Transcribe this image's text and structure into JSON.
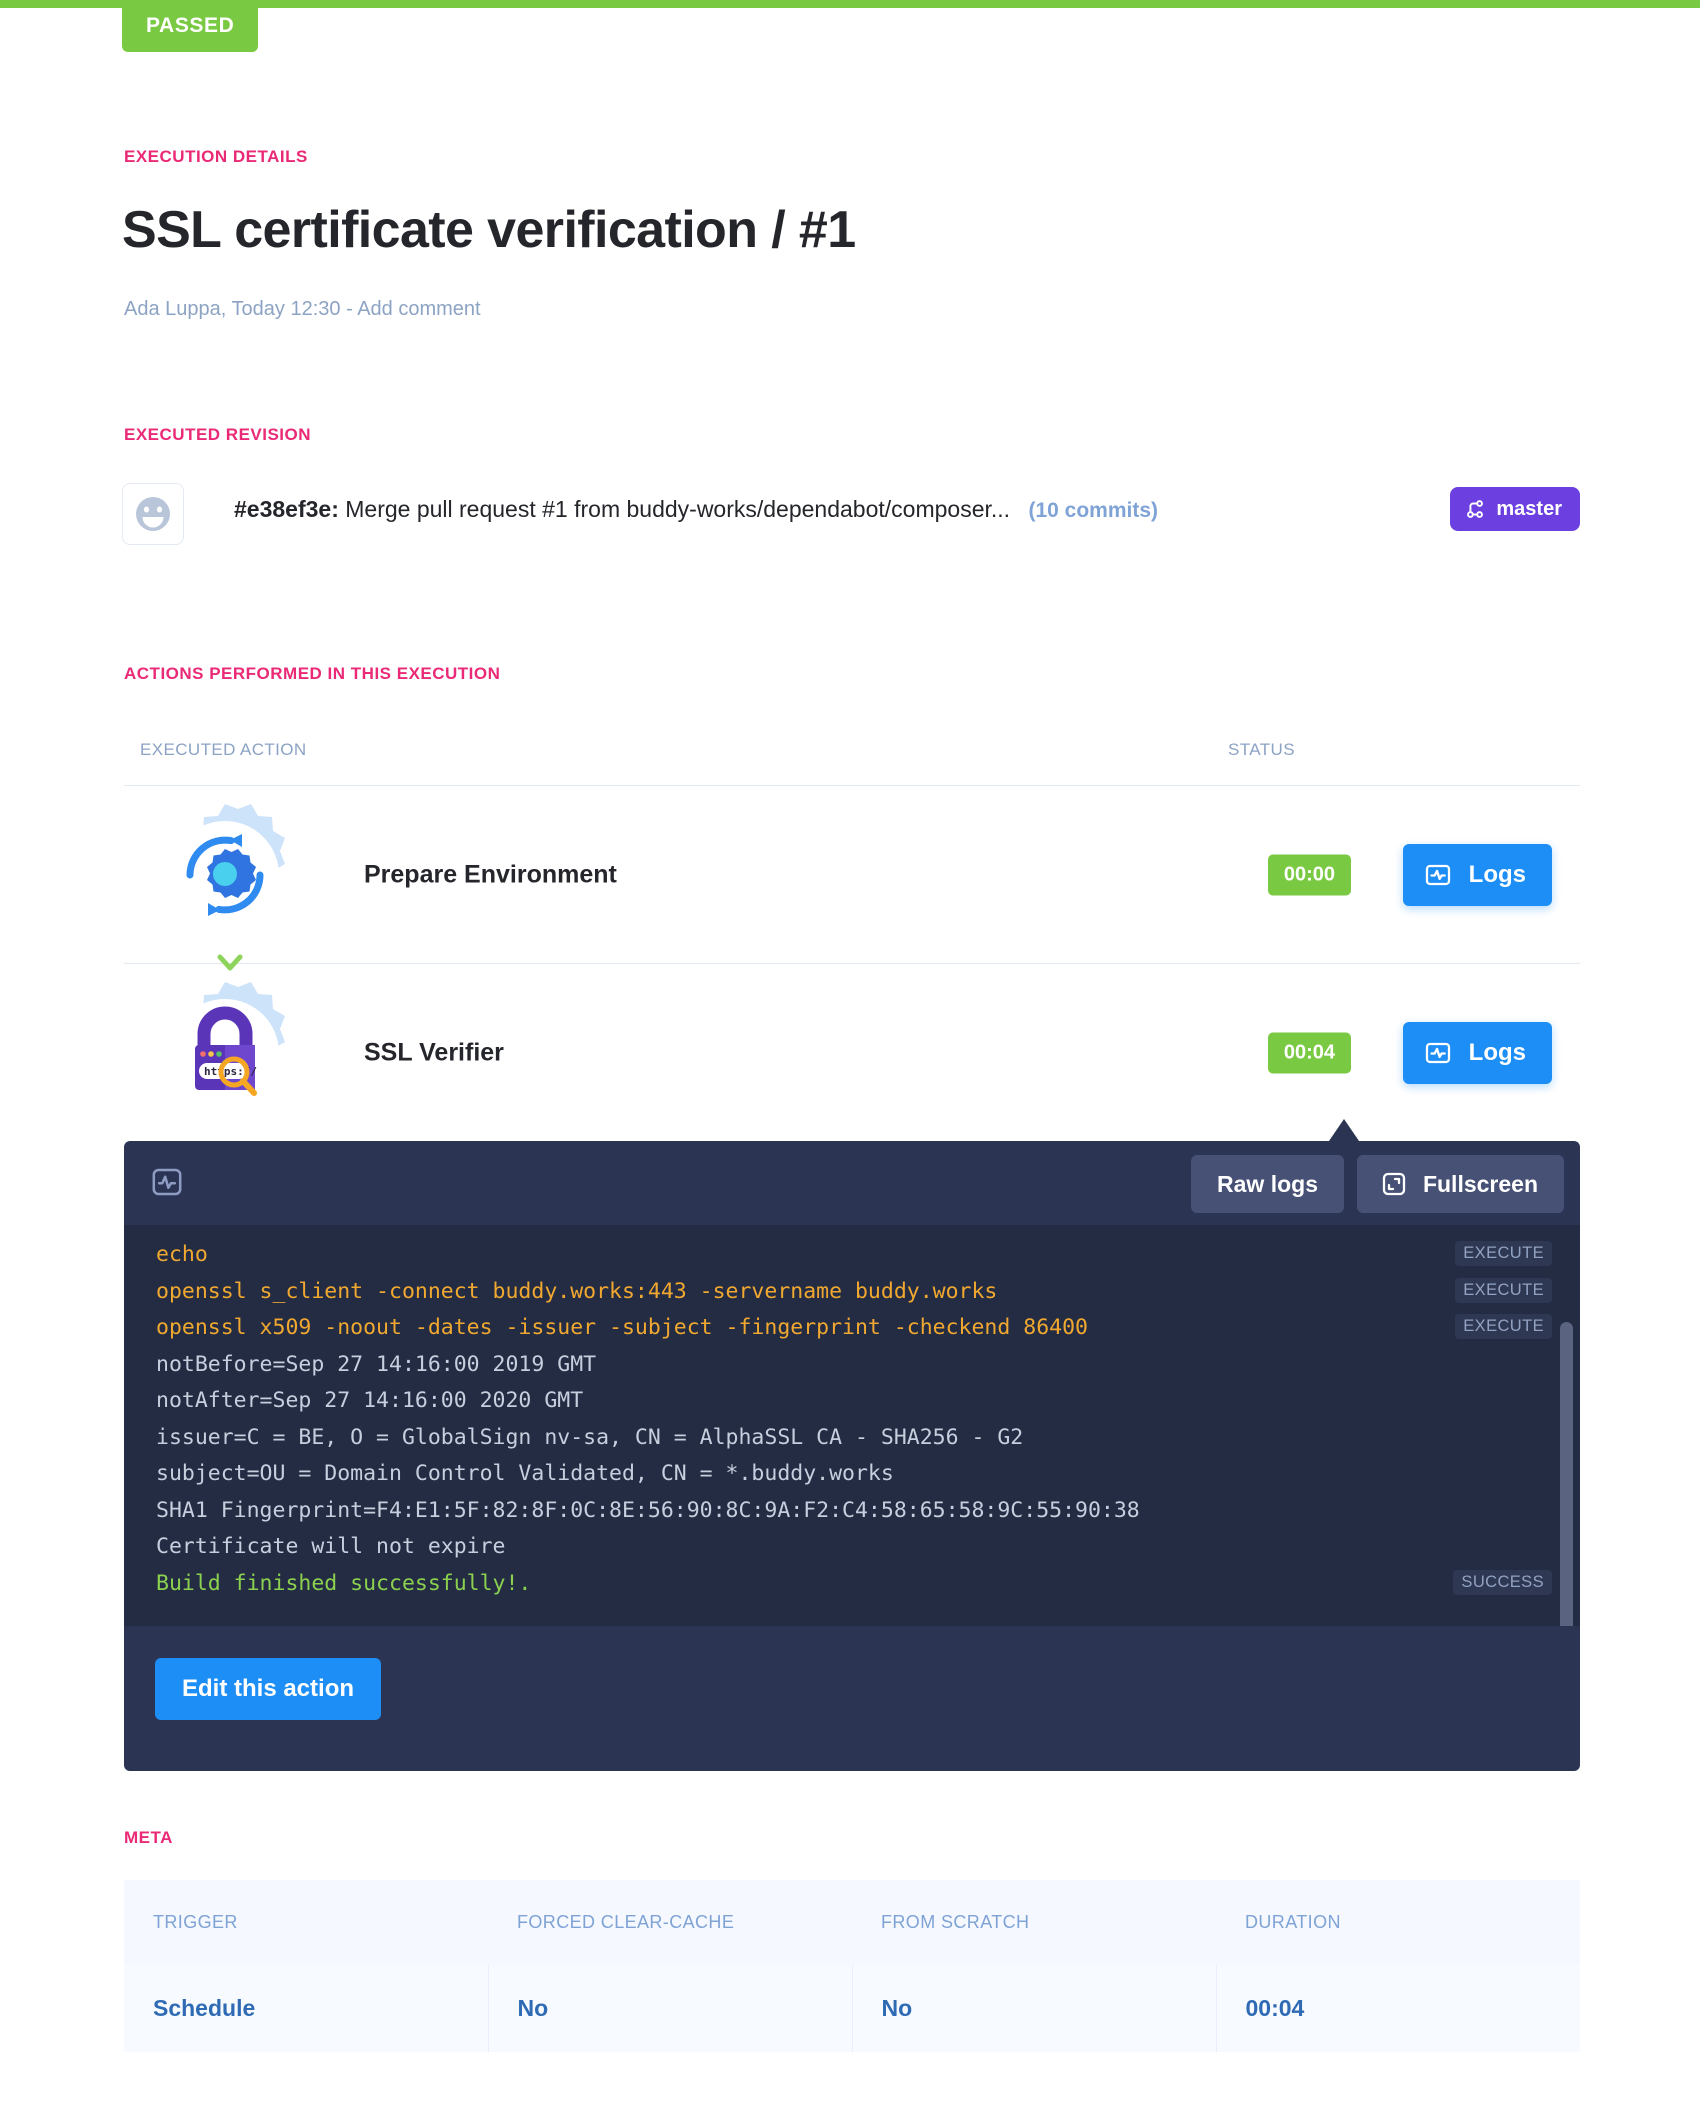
{
  "status_bar": {
    "badge_label": "PASSED",
    "color": "#7ac943"
  },
  "header": {
    "section_label": "EXECUTION DETAILS",
    "title": "SSL certificate verification / #1",
    "author": "Ada Luppa,",
    "timestamp": "Today 12:30",
    "separator": "-",
    "comment_link": "Add comment"
  },
  "revision": {
    "section_label": "EXECUTED REVISION",
    "hash": "#e38ef3e:",
    "message": "Merge pull request #1 from buddy-works/dependabot/composer...",
    "commits": "(10 commits)",
    "branch": "master",
    "branch_color": "#6c3fe0"
  },
  "actions": {
    "section_label": "ACTIONS PERFORMED IN THIS EXECUTION",
    "columns": {
      "action": "EXECUTED ACTION",
      "status": "STATUS"
    },
    "rows": [
      {
        "name": "Prepare Environment",
        "icon": "gear-refresh-icon",
        "duration": "00:00",
        "logs_label": "Logs"
      },
      {
        "name": "SSL Verifier",
        "icon": "ssl-padlock-icon",
        "duration": "00:04",
        "logs_label": "Logs"
      }
    ]
  },
  "logs_panel": {
    "raw_logs_label": "Raw logs",
    "fullscreen_label": "Fullscreen",
    "edit_label": "Edit this action",
    "lines": [
      {
        "text": "echo",
        "kind": "cmd",
        "tag": "EXECUTE"
      },
      {
        "text": "openssl s_client -connect buddy.works:443 -servername buddy.works",
        "kind": "cmd",
        "tag": "EXECUTE"
      },
      {
        "text": "openssl x509 -noout -dates -issuer -subject -fingerprint -checkend 86400",
        "kind": "cmd",
        "tag": "EXECUTE"
      },
      {
        "text": "notBefore=Sep 27 14:16:00 2019 GMT",
        "kind": "out",
        "tag": ""
      },
      {
        "text": "notAfter=Sep 27 14:16:00 2020 GMT",
        "kind": "out",
        "tag": ""
      },
      {
        "text": "issuer=C = BE, O = GlobalSign nv-sa, CN = AlphaSSL CA - SHA256 - G2",
        "kind": "out",
        "tag": ""
      },
      {
        "text": "subject=OU = Domain Control Validated, CN = *.buddy.works",
        "kind": "out",
        "tag": ""
      },
      {
        "text": "SHA1 Fingerprint=F4:E1:5F:82:8F:0C:8E:56:90:8C:9A:F2:C4:58:65:58:9C:55:90:38",
        "kind": "out",
        "tag": ""
      },
      {
        "text": "Certificate will not expire",
        "kind": "out",
        "tag": ""
      },
      {
        "text": "Build finished successfully!.",
        "kind": "ok",
        "tag": "SUCCESS"
      }
    ]
  },
  "meta": {
    "section_label": "META",
    "headers": [
      "TRIGGER",
      "FORCED CLEAR-CACHE",
      "FROM SCRATCH",
      "DURATION"
    ],
    "values": [
      "Schedule",
      "No",
      "No",
      "00:04"
    ]
  }
}
